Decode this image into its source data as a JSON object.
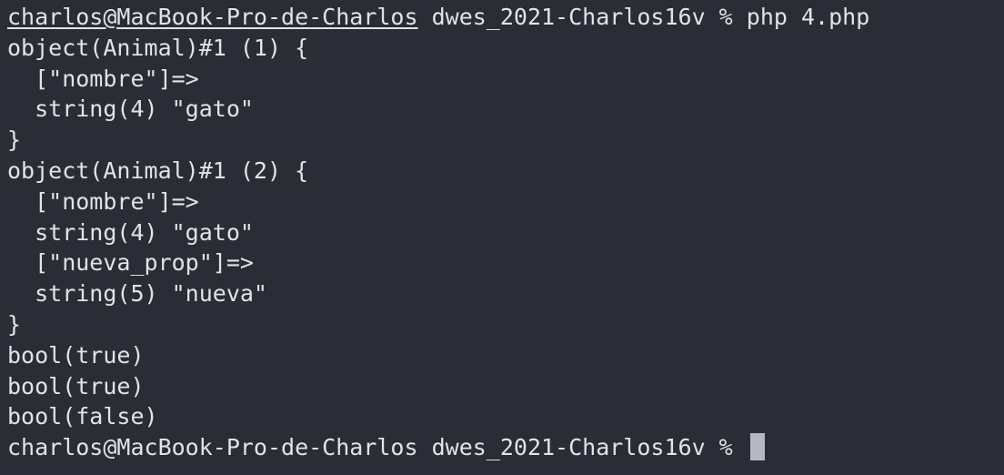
{
  "terminal": {
    "prompt1": {
      "user_host": "charlos@MacBook-Pro-de-Charlos",
      "rest": " dwes_2021-Charlos16v % php 4.php"
    },
    "output": [
      "object(Animal)#1 (1) {",
      "  [\"nombre\"]=>",
      "  string(4) \"gato\"",
      "}",
      "object(Animal)#1 (2) {",
      "  [\"nombre\"]=>",
      "  string(4) \"gato\"",
      "  [\"nueva_prop\"]=>",
      "  string(5) \"nueva\"",
      "}",
      "bool(true)",
      "bool(true)",
      "bool(false)"
    ],
    "prompt2": "charlos@MacBook-Pro-de-Charlos dwes_2021-Charlos16v % ",
    "colors": {
      "background": "#2a2d36",
      "text": "#dfe3ea",
      "cursor": "#b5b8c4"
    }
  }
}
